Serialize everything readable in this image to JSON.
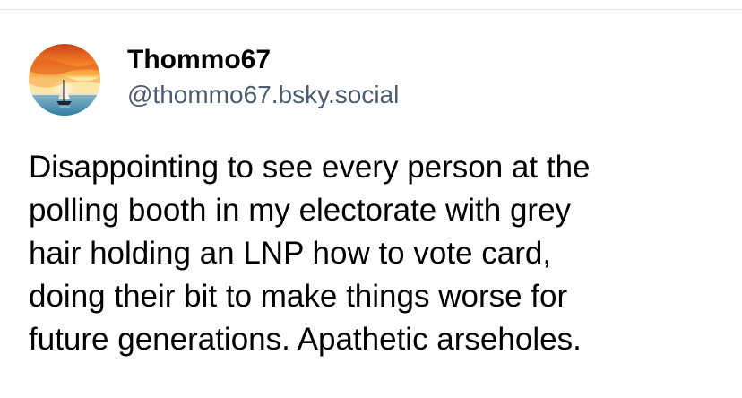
{
  "post": {
    "author": {
      "display_name": "Thommo67",
      "handle": "@thommo67.bsky.social",
      "avatar_icon": "sunset-sailboat-avatar"
    },
    "text_lines": [
      "Disappointing to see every person at the",
      "polling booth in my electorate with grey",
      "hair holding an LNP how to vote card,",
      "doing their bit to make things worse for",
      "future generations. Apathetic arseholes."
    ]
  },
  "colors": {
    "background": "#ffffff",
    "text": "#000000",
    "handle": "#4e5d6d",
    "divider": "#e3e6ea"
  }
}
